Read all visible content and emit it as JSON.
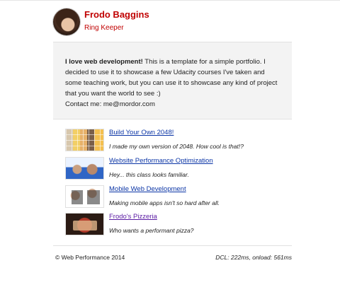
{
  "header": {
    "name": "Frodo Baggins",
    "role": "Ring Keeper"
  },
  "intro": {
    "lead": "I love web development!",
    "body": " This is a template for a simple portfolio. I decided to use it to showcase a few Udacity courses I've taken and some teaching work, but you can use it to showcase any kind of project that you want the world to see :)",
    "contact_label": "Contact me:",
    "contact_email": "me@mordor.com"
  },
  "projects": [
    {
      "title": "Build Your Own 2048!",
      "desc": "I made my own version of 2048. How cool is that!?",
      "thumb": "2048-thumbnail",
      "visited": false
    },
    {
      "title": "Website Performance Optimization",
      "desc": "Hey... this class looks familiar.",
      "thumb": "instructor-thumbnail",
      "visited": false
    },
    {
      "title": "Mobile Web Development",
      "desc": "Making mobile apps isn't so hard after all.",
      "thumb": "mobile-devices-thumbnail",
      "visited": false
    },
    {
      "title": "Frodo's Pizzeria",
      "desc": "Who wants a performant pizza?",
      "thumb": "pizzeria-thumbnail",
      "visited": true
    }
  ],
  "footer": {
    "left": "© Web Performance 2014",
    "right": "DCL: 222ms, onload: 561ms"
  },
  "colors": {
    "accent": "#c00000",
    "link": "#0b35a6",
    "visited_link": "#5a1aa3",
    "panel": "#f3f3f3"
  }
}
